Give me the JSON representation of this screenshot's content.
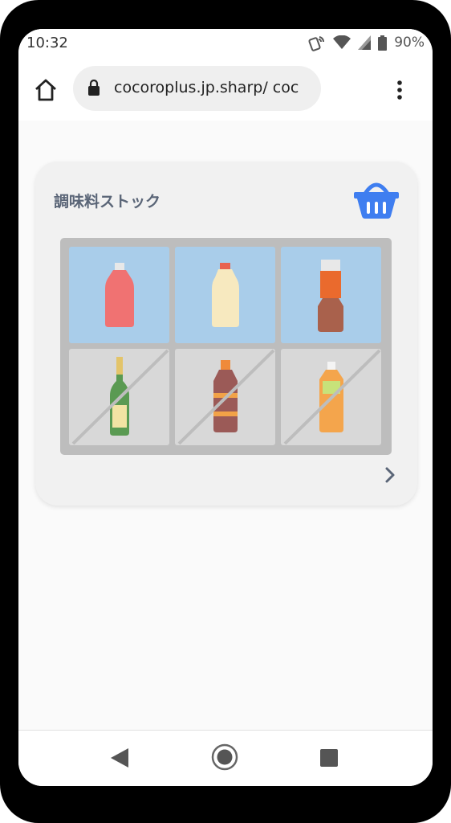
{
  "status_bar": {
    "time": "10:32",
    "battery": "90%"
  },
  "browser": {
    "url": "cocoroplus.jp.sharp/ coc"
  },
  "card": {
    "title": "調味料ストック",
    "shelf": [
      {
        "item": "ketchup-bottle",
        "state": "in-stock"
      },
      {
        "item": "mayonnaise-bottle",
        "state": "in-stock"
      },
      {
        "item": "sauce-bottle",
        "state": "in-stock"
      },
      {
        "item": "wine-bottle",
        "state": "out-of-stock"
      },
      {
        "item": "soy-sauce-bottle",
        "state": "out-of-stock"
      },
      {
        "item": "drink-bottle",
        "state": "out-of-stock"
      }
    ]
  },
  "colors": {
    "accent_blue": "#3f7ef0",
    "title_gray": "#5a6577",
    "full_slot": "#a9cdea",
    "empty_slot": "#d8d8d8"
  }
}
